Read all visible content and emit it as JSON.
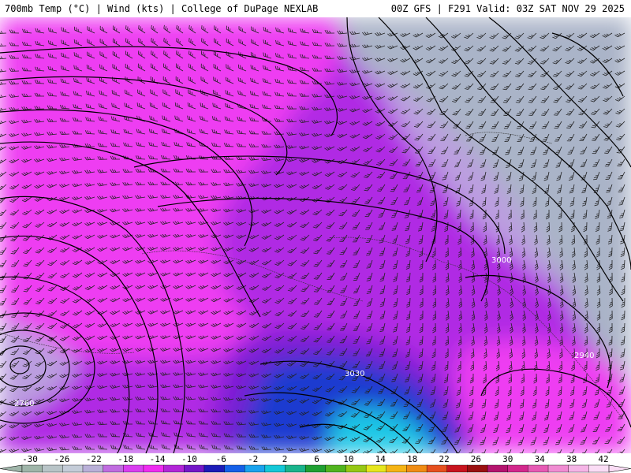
{
  "header": {
    "left_title": "700mb Temp (°C) | Wind (kts) | College of DuPage NEXLAB",
    "right_title": "00Z GFS | F291 Valid: 03Z SAT NOV 29 2025"
  },
  "map": {
    "contour_labels": [
      "3000",
      "2940",
      "3030",
      "2760"
    ],
    "icons": [
      "wind-barb-icon"
    ]
  },
  "colorbar": {
    "tick_labels": [
      "-30",
      "-26",
      "-22",
      "-18",
      "-14",
      "-10",
      "-6",
      "-2",
      "2",
      "6",
      "10",
      "14",
      "18",
      "22",
      "26",
      "30",
      "34",
      "38",
      "42"
    ],
    "colors": [
      "#9fb5a9",
      "#b8c4c7",
      "#c4ccd8",
      "#b9b0d8",
      "#c06ce0",
      "#d93ef0",
      "#ee2cf0",
      "#b225d8",
      "#7418c8",
      "#1c1cb8",
      "#1560e8",
      "#1aa3ee",
      "#14c8d8",
      "#19b48c",
      "#1fa032",
      "#50b41e",
      "#96c814",
      "#e6e61e",
      "#f5b414",
      "#f08c14",
      "#e6501e",
      "#c8141e",
      "#9a1010",
      "#b4146e",
      "#d2288c",
      "#e65ab4",
      "#f08cd2",
      "#f5b4e6",
      "#fadcf5"
    ]
  },
  "legend_colors": {
    "cold_gray": "#aab4c8",
    "lavender": "#bb9ee0",
    "magenta": "#ee3cf2",
    "purple": "#b02ce4",
    "violet": "#7a1fd4",
    "blue": "#1a3ad0",
    "cyan": "#1ec8e6",
    "contour": "#000000"
  }
}
